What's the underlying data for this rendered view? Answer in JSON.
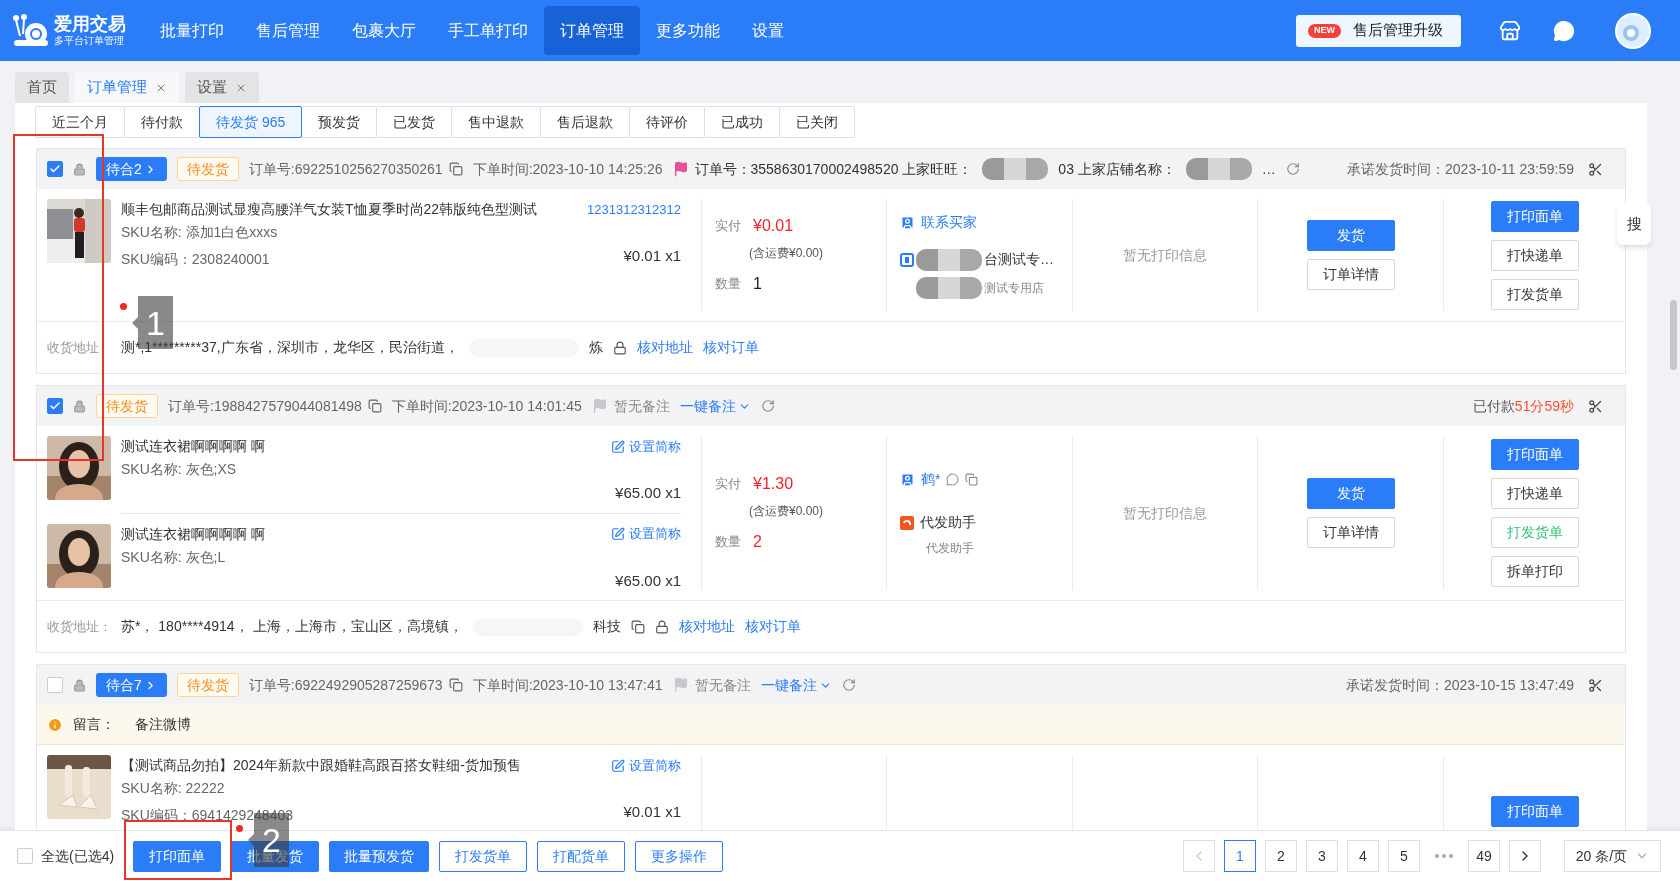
{
  "app": {
    "logo_title": "爱用交易",
    "logo_subtitle": "多平台订单管理"
  },
  "nav": [
    {
      "label": "批量打印",
      "selected": false
    },
    {
      "label": "售后管理",
      "selected": false
    },
    {
      "label": "包裹大厅",
      "selected": false
    },
    {
      "label": "手工单打印",
      "selected": false
    },
    {
      "label": "订单管理",
      "selected": true
    },
    {
      "label": "更多功能",
      "selected": false
    },
    {
      "label": "设置",
      "selected": false
    }
  ],
  "promo": {
    "badge": "NEW",
    "label": "售后管理升级"
  },
  "page_tabs": [
    {
      "label": "首页",
      "selected": false,
      "closable": false
    },
    {
      "label": "订单管理",
      "selected": true,
      "closable": true
    },
    {
      "label": "设置",
      "selected": false,
      "closable": true
    }
  ],
  "status_tabs": [
    {
      "label": "近三个月",
      "selected": false
    },
    {
      "label": "待付款",
      "selected": false
    },
    {
      "label": "待发货 965",
      "selected": true
    },
    {
      "label": "预发货",
      "selected": false
    },
    {
      "label": "已发货",
      "selected": false
    },
    {
      "label": "售中退款",
      "selected": false
    },
    {
      "label": "售后退款",
      "selected": false
    },
    {
      "label": "待评价",
      "selected": false
    },
    {
      "label": "已成功",
      "selected": false
    },
    {
      "label": "已关闭",
      "selected": false
    }
  ],
  "orders": [
    {
      "checked": true,
      "header_left": [
        {
          "kind": "merge",
          "text": "待合2"
        },
        {
          "kind": "status",
          "text": "待发货"
        },
        {
          "kind": "order_no",
          "text": "订单号:6922510256270350261"
        },
        {
          "kind": "time",
          "text": "下单时间:2023-10-10 14:25:26"
        },
        {
          "kind": "flag",
          "flagged": true,
          "text": "订单号：3558630170002498520 上家旺旺："
        },
        {
          "kind": "redacted"
        },
        {
          "kind": "text",
          "text": "03 上家店铺名称："
        },
        {
          "kind": "redacted"
        },
        {
          "kind": "text",
          "text": "…"
        },
        {
          "kind": "refresh"
        }
      ],
      "header_right": [
        {
          "kind": "time",
          "text": "承诺发货时间：2023-10-11 23:59:59"
        },
        {
          "kind": "scissors"
        }
      ],
      "products": [
        {
          "title": "顺丰包邮商品测试显瘦高腰洋气女装T恤夏季时尚22韩版纯色型测试",
          "link": "1231312312312",
          "sku_name": "SKU名称: 添加1白色xxxs",
          "sku_code": "SKU编码：2308240001",
          "price": "¥0.01 x1"
        }
      ],
      "payment": {
        "label": "实付",
        "amount": "¥0.01",
        "shipping": "(含运费¥0.00)",
        "qty_label": "数量",
        "qty": "1",
        "qty_alert": false
      },
      "buyer": [
        {
          "kind": "contact",
          "text": "联系买家",
          "tools": false
        },
        {
          "kind": "shop",
          "name": "台测试专…",
          "sub": "测试专用店"
        }
      ],
      "print_info": "暂无打印信息",
      "ship_buttons": [
        {
          "label": "发货",
          "kind": "primary"
        },
        {
          "label": "订单详情",
          "kind": "default"
        }
      ],
      "print_buttons": [
        {
          "label": "打印面单",
          "kind": "primary"
        },
        {
          "label": "打快递单",
          "kind": "default"
        },
        {
          "label": "打发货单",
          "kind": "default"
        }
      ],
      "address": {
        "label": "收货地址",
        "text": "测*,1*********37,广东省，深圳市，龙华区，民治街道，",
        "tail": "炼",
        "copy": false,
        "links": [
          "核对地址",
          "核对订单"
        ]
      }
    },
    {
      "checked": true,
      "header_left": [
        {
          "kind": "status",
          "text": "待发货"
        },
        {
          "kind": "order_no",
          "text": "订单号:1988427579044081498"
        },
        {
          "kind": "time",
          "text": "下单时间:2023-10-10 14:01:45"
        },
        {
          "kind": "flag",
          "flagged": false,
          "text": "暂无备注"
        },
        {
          "kind": "dropdown",
          "text": "一键备注"
        },
        {
          "kind": "refresh"
        }
      ],
      "header_right": [
        {
          "kind": "countdown",
          "text": "已付款",
          "value": "51分59秒"
        },
        {
          "kind": "scissors"
        }
      ],
      "products": [
        {
          "title": "测试连衣裙啊啊啊啊 啊",
          "action": "设置简称",
          "sku_name": "SKU名称: 灰色;XS",
          "price": "¥65.00 x1"
        },
        {
          "title": "测试连衣裙啊啊啊啊 啊",
          "action": "设置简称",
          "sku_name": "SKU名称: 灰色;L",
          "price": "¥65.00 x1"
        }
      ],
      "payment": {
        "label": "实付",
        "amount": "¥1.30",
        "shipping": "(含运费¥0.00)",
        "qty_label": "数量",
        "qty": "2",
        "qty_alert": true
      },
      "buyer": [
        {
          "kind": "contact",
          "text": "鹤*",
          "tools": true
        },
        {
          "kind": "agent",
          "name": "代发助手",
          "sub": "代发助手"
        }
      ],
      "print_info": "暂无打印信息",
      "ship_buttons": [
        {
          "label": "发货",
          "kind": "primary"
        },
        {
          "label": "订单详情",
          "kind": "default"
        }
      ],
      "print_buttons": [
        {
          "label": "打印面单",
          "kind": "primary"
        },
        {
          "label": "打快递单",
          "kind": "default"
        },
        {
          "label": "打发货单",
          "kind": "success"
        },
        {
          "label": "拆单打印",
          "kind": "default"
        }
      ],
      "address": {
        "label": "收货地址：",
        "text": "苏*， 180****4914， 上海，上海市，宝山区，高境镇，",
        "tail": "科技",
        "copy": true,
        "links": [
          "核对地址",
          "核对订单"
        ]
      }
    },
    {
      "checked": false,
      "header_left": [
        {
          "kind": "merge",
          "text": "待合7"
        },
        {
          "kind": "status",
          "text": "待发货"
        },
        {
          "kind": "order_no",
          "text": "订单号:6922492905287259673"
        },
        {
          "kind": "time",
          "text": "下单时间:2023-10-10 13:47:41"
        },
        {
          "kind": "flag",
          "flagged": false,
          "text": "暂无备注"
        },
        {
          "kind": "dropdown",
          "text": "一键备注"
        },
        {
          "kind": "refresh"
        }
      ],
      "header_right": [
        {
          "kind": "time",
          "text": "承诺发货时间：2023-10-15 13:47:49"
        },
        {
          "kind": "scissors"
        }
      ],
      "message": {
        "label": "留言：",
        "text": "备注微博"
      },
      "products": [
        {
          "title": "【测试商品勿拍】2024年新款中跟婚鞋高跟百搭女鞋细-货加预售",
          "action": "设置简称",
          "sku_name": "SKU名称: 22222",
          "sku_code": "SKU编码：6941429248403",
          "price": "¥0.01 x1"
        }
      ],
      "print_buttons": [
        {
          "label": "打印面单",
          "kind": "primary"
        }
      ]
    }
  ],
  "side_button": "搜",
  "footer": {
    "select_all": {
      "label": "全选(已选4)",
      "checked": false
    },
    "buttons": [
      {
        "label": "打印面单",
        "kind": "primary"
      },
      {
        "label": "批量发货",
        "kind": "primary"
      },
      {
        "label": "批量预发货",
        "kind": "primary"
      },
      {
        "label": "打发货单",
        "kind": "outline"
      },
      {
        "label": "打配货单",
        "kind": "outline"
      },
      {
        "label": "更多操作",
        "kind": "outline"
      }
    ],
    "pagination": {
      "prev_disabled": true,
      "pages": [
        {
          "label": "1",
          "selected": true
        },
        {
          "label": "2",
          "selected": false
        },
        {
          "label": "3",
          "selected": false
        },
        {
          "label": "4",
          "selected": false
        },
        {
          "label": "5",
          "selected": false
        }
      ],
      "last_page": {
        "label": "49",
        "selected": false
      },
      "page_size": "20 条/页"
    }
  },
  "annotations": [
    {
      "label": "1"
    },
    {
      "label": "2"
    }
  ]
}
